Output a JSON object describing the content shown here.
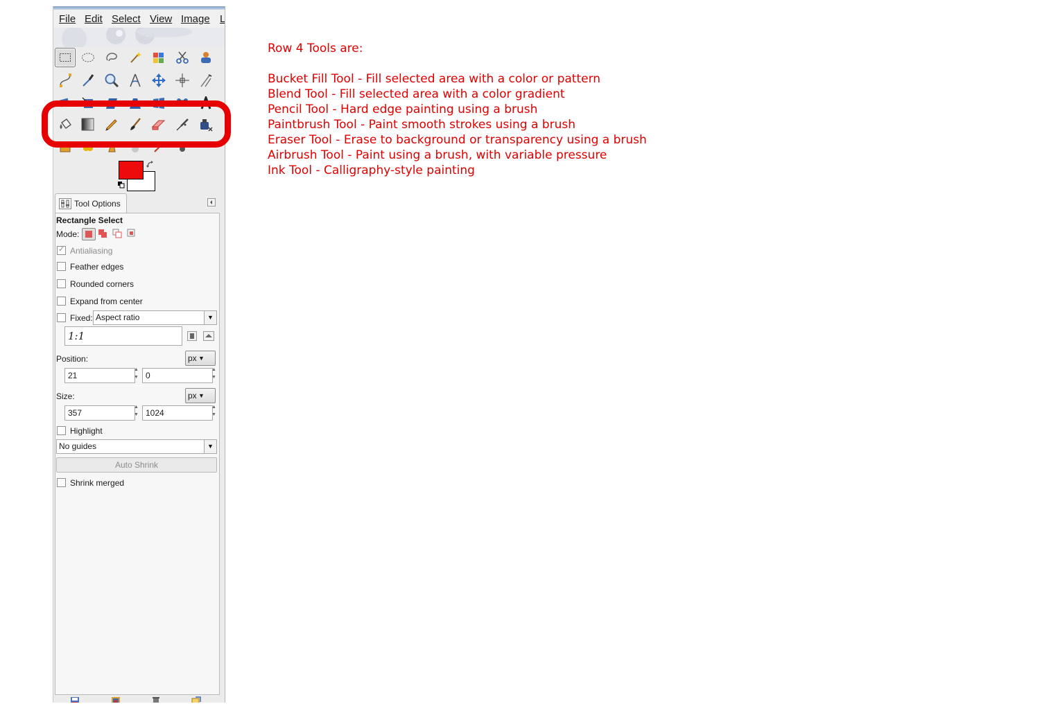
{
  "menubar": {
    "items": [
      {
        "label": "File"
      },
      {
        "label": "Edit"
      },
      {
        "label": "Select"
      },
      {
        "label": "View"
      },
      {
        "label": "Image"
      },
      {
        "label": "L"
      }
    ]
  },
  "toolbox": {
    "rows": [
      [
        "rect-select-icon",
        "ellipse-select-icon",
        "free-select-icon",
        "fuzzy-select-icon",
        "select-by-color-icon",
        "scissors-icon",
        "foreground-select-icon"
      ],
      [
        "paths-icon",
        "color-picker-icon",
        "zoom-icon",
        "measure-icon",
        "move-icon",
        "align-icon",
        "crop-icon"
      ],
      [
        "rotate-icon",
        "scale-icon",
        "shear-icon",
        "perspective-icon",
        "flip-icon",
        "cage-transform-icon",
        "text-icon"
      ],
      [
        "bucket-fill-icon",
        "blend-icon",
        "pencil-icon",
        "paintbrush-icon",
        "eraser-icon",
        "airbrush-icon",
        "ink-icon"
      ],
      [
        "clone-icon",
        "heal-icon",
        "perspective-clone-icon",
        "blur-icon",
        "smudge-icon",
        "dodge-burn-icon",
        "extra-icon"
      ]
    ],
    "foreground_color": "#ee0b0b",
    "background_color": "#ffffff",
    "highlight_color": "#e60000"
  },
  "dock": {
    "tab_label": "Tool Options",
    "tool_name": "Rectangle Select",
    "mode_label": "Mode:",
    "antialiasing": {
      "label": "Antialiasing",
      "checked": true
    },
    "feather_edges": {
      "label": "Feather edges",
      "checked": false
    },
    "rounded_corners": {
      "label": "Rounded corners",
      "checked": false
    },
    "expand_from_center": {
      "label": "Expand from center",
      "checked": false
    },
    "fixed": {
      "label": "Fixed:",
      "checked": false,
      "value": "Aspect ratio"
    },
    "ratio_value": "1:1",
    "position": {
      "label": "Position:",
      "unit": "px",
      "x": "21",
      "y": "0"
    },
    "size": {
      "label": "Size:",
      "unit": "px",
      "w": "357",
      "h": "1024"
    },
    "highlight": {
      "label": "Highlight",
      "checked": false
    },
    "guides": "No guides",
    "auto_shrink_label": "Auto Shrink",
    "shrink_merged": {
      "label": "Shrink merged",
      "checked": false
    }
  },
  "notes": {
    "heading": "Row 4 Tools are:",
    "lines": [
      "Bucket Fill Tool - Fill selected area with a color or pattern",
      "Blend Tool - Fill selected area with a color gradient",
      "Pencil Tool - Hard edge painting using a brush",
      "Paintbrush Tool - Paint smooth strokes using a brush",
      "Eraser Tool - Erase to background or transparency using a brush",
      "Airbrush Tool - Paint using a brush, with variable pressure",
      "Ink Tool - Calligraphy-style painting"
    ],
    "color": "#e10000"
  }
}
